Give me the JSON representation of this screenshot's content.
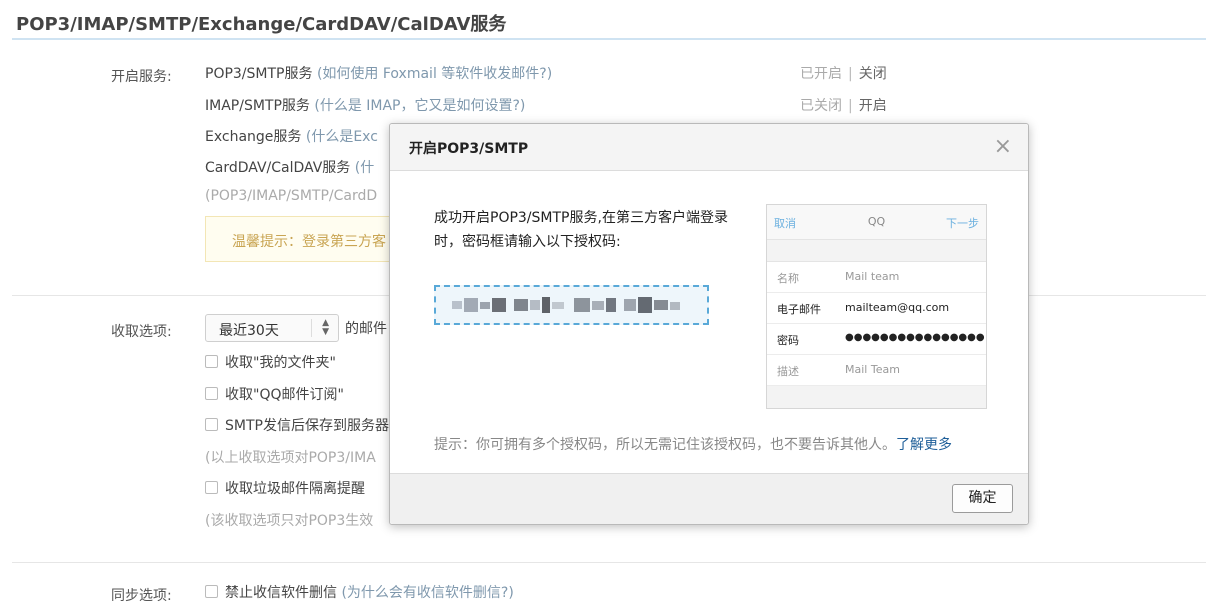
{
  "page": {
    "title": "POP3/IMAP/SMTP/Exchange/CardDAV/CalDAV服务"
  },
  "services": {
    "label": "开启服务:",
    "items": [
      {
        "name": "POP3/SMTP服务",
        "help": "(如何使用 Foxmail 等软件收发邮件?)",
        "status": "已开启",
        "action": "关闭"
      },
      {
        "name": "IMAP/SMTP服务",
        "help": "(什么是 IMAP，它又是如何设置?)",
        "status": "已关闭",
        "action": "开启"
      },
      {
        "name": "Exchange服务",
        "help": "(什么是Exc"
      },
      {
        "name": "CardDAV/CalDAV服务",
        "help": "(什"
      }
    ],
    "note": "(POP3/IMAP/SMTP/CardD",
    "warning": "温馨提示：登录第三方客"
  },
  "receive": {
    "label": "收取选项:",
    "select_value": "最近30天",
    "select_suffix": "的邮件",
    "opt1": "收取\"我的文件夹\"",
    "opt2": "收取\"QQ邮件订阅\"",
    "opt3": "SMTP发信后保存到服务器",
    "note1": "(以上收取选项对POP3/IMA",
    "opt4": "收取垃圾邮件隔离提醒",
    "note2": "(该收取选项只对POP3生效"
  },
  "sync": {
    "label": "同步选项:",
    "opt1": "禁止收信软件删信",
    "help": "(为什么会有收信软件删信?)"
  },
  "dialog": {
    "title": "开启POP3/SMTP",
    "close": "×",
    "message": "成功开启POP3/SMTP服务,在第三方客户端登录时，密码框请输入以下授权码:",
    "tip": "提示：你可拥有多个授权码，所以无需记住该授权码，也不要告诉其他人。",
    "learn_more": "了解更多",
    "ok": "确定",
    "phone": {
      "cancel": "取消",
      "title": "QQ",
      "next": "下一步",
      "rows": [
        {
          "k": "名称",
          "v": "Mail team"
        },
        {
          "k": "电子邮件",
          "v": "mailteam@qq.com"
        },
        {
          "k": "密码",
          "v": "●●●●●●●●●●●●●●●●"
        },
        {
          "k": "描述",
          "v": "Mail Team"
        }
      ]
    }
  },
  "colors": {
    "accent": "#59a9d8",
    "link": "#1f5f99",
    "hint": "#7f98ad"
  }
}
